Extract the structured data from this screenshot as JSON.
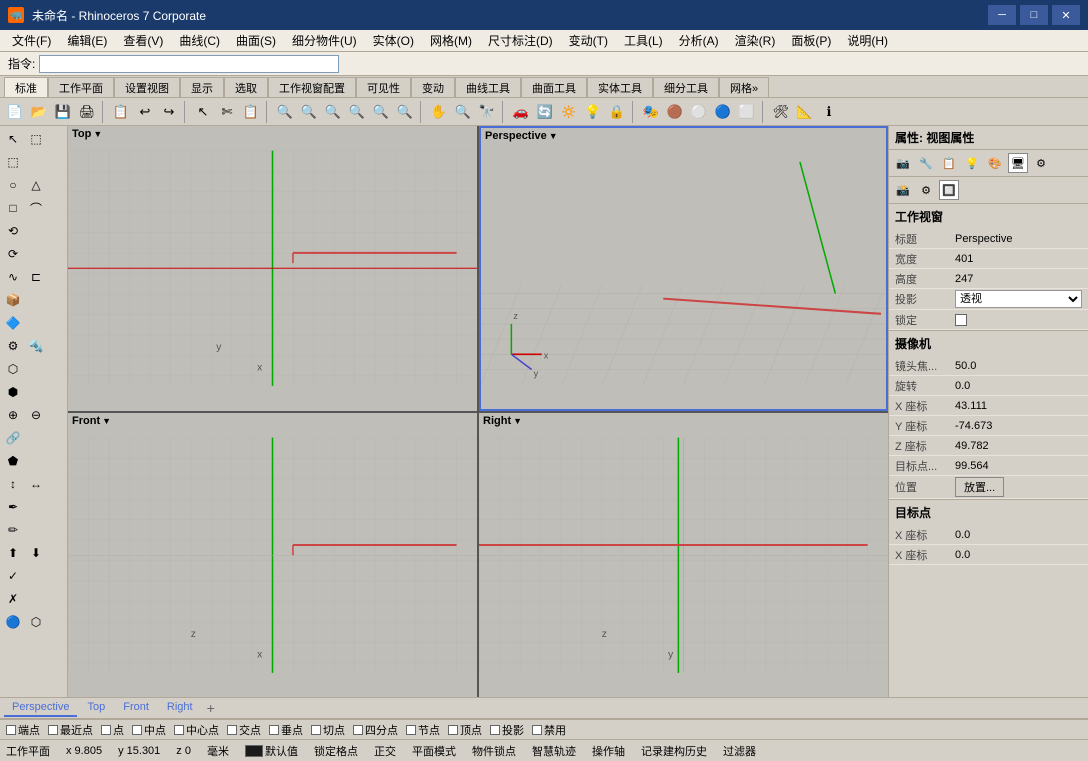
{
  "titlebar": {
    "icon": "🦏",
    "title": "未命名 - Rhinoceros 7 Corporate",
    "minimize": "─",
    "maximize": "□",
    "close": "✕"
  },
  "menu": {
    "items": [
      "文件(F)",
      "编辑(E)",
      "查看(V)",
      "曲线(C)",
      "曲面(S)",
      "细分物件(U)",
      "实体(O)",
      "网格(M)",
      "尺寸标注(D)",
      "变动(T)",
      "工具(L)",
      "分析(A)",
      "渲染(R)",
      "面板(P)",
      "说明(H)"
    ]
  },
  "command": {
    "label": "指令:",
    "placeholder": ""
  },
  "toolbar_tabs": {
    "tabs": [
      "标准",
      "工作平面",
      "设置视图",
      "显示",
      "选取",
      "工作视窗配置",
      "可见性",
      "变动",
      "曲线工具",
      "曲面工具",
      "实体工具",
      "细分工具",
      "网格»"
    ],
    "active": "标准"
  },
  "viewports": {
    "top_left": {
      "label": "Top",
      "dropdown": "▼"
    },
    "top_right": {
      "label": "Perspective",
      "dropdown": "▼"
    },
    "bottom_left": {
      "label": "Front",
      "dropdown": "▼"
    },
    "bottom_right": {
      "label": "Right",
      "dropdown": "▼"
    }
  },
  "properties_panel": {
    "title": "属性: 视图属性",
    "section_viewport": "工作视窗",
    "rows": [
      {
        "label": "标题",
        "value": "Perspective"
      },
      {
        "label": "宽度",
        "value": "401"
      },
      {
        "label": "高度",
        "value": "247"
      },
      {
        "label": "投影",
        "value": "透视",
        "has_select": true
      },
      {
        "label": "锁定",
        "value": "",
        "has_checkbox": true
      }
    ],
    "section_camera": "摄像机",
    "camera_rows": [
      {
        "label": "镜头焦...",
        "value": "50.0"
      },
      {
        "label": "旋转",
        "value": "0.0"
      },
      {
        "label": "X 座标",
        "value": "43.111"
      },
      {
        "label": "Y 座标",
        "value": "-74.673"
      },
      {
        "label": "Z 座标",
        "value": "49.782"
      },
      {
        "label": "目标点...",
        "value": "99.564"
      },
      {
        "label": "位置",
        "value": "放置...",
        "has_btn": true
      }
    ],
    "section_target": "目标点",
    "target_rows": [
      {
        "label": "X 座标",
        "value": "0.0"
      },
      {
        "label": "X 座标",
        "value": "0.0"
      }
    ]
  },
  "viewport_tabs": {
    "tabs": [
      "Perspective",
      "Top",
      "Front",
      "Right"
    ],
    "active": "Perspective",
    "add": "+"
  },
  "status_bar": {
    "items": [
      "端点",
      "最近点",
      "点",
      "中点",
      "中心点",
      "交点",
      "垂点",
      "切点",
      "四分点",
      "节点",
      "顶点",
      "投影",
      "禁用"
    ]
  },
  "bottom_bar": {
    "plane": "工作平面",
    "x": "x 9.805",
    "y": "y 15.301",
    "z": "z 0",
    "unit": "毫米",
    "swatch_label": "默认值",
    "items": [
      "锁定格点",
      "正交",
      "平面模式",
      "物件锁点",
      "智慧轨迹",
      "操作轴",
      "记录建构历史",
      "过滤器"
    ]
  },
  "icons": {
    "file_new": "📄",
    "file_open": "📂",
    "file_save": "💾",
    "print": "🖨",
    "undo": "↩",
    "redo": "↪",
    "cut": "✂",
    "copy": "📋",
    "paste": "📋",
    "select": "↖",
    "zoom": "🔍",
    "pan": "✋"
  }
}
